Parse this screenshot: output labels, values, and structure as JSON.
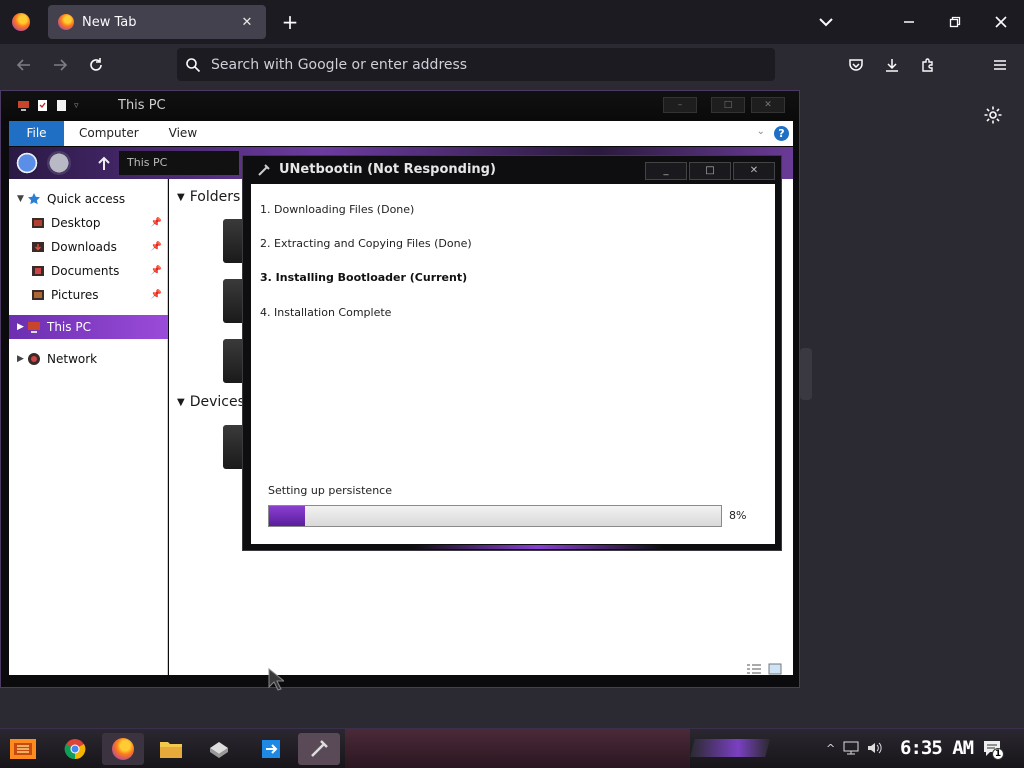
{
  "browser": {
    "tab_title": "New Tab",
    "tab_close": "✕",
    "new_tab": "+",
    "url_placeholder": "Search with Google or enter address"
  },
  "explorer": {
    "title": "This PC",
    "ribbon_tabs": [
      "File",
      "Computer",
      "View"
    ],
    "address": "This PC",
    "nav": {
      "quick_access": "Quick access",
      "desktop": "Desktop",
      "downloads": "Downloads",
      "documents": "Documents",
      "pictures": "Pictures",
      "this_pc": "This PC",
      "network": "Network"
    },
    "groups": {
      "folders": "Folders (",
      "devices": "Devices a"
    }
  },
  "unetbootin": {
    "title": "UNetbootin (Not Responding)",
    "steps": [
      "1. Downloading Files (Done)",
      "2. Extracting and Copying Files (Done)",
      "3. Installing Bootloader (Current)",
      "4. Installation Complete"
    ],
    "status": "Setting up persistence",
    "progress_percent": 8,
    "progress_label": "8%"
  },
  "taskbar": {
    "clock": "6:35 AM",
    "notification_count": "1"
  },
  "colors": {
    "accent_purple": "#7a35c0",
    "file_tab_blue": "#1f6fc5",
    "firefox_bg": "#2b2a33"
  }
}
